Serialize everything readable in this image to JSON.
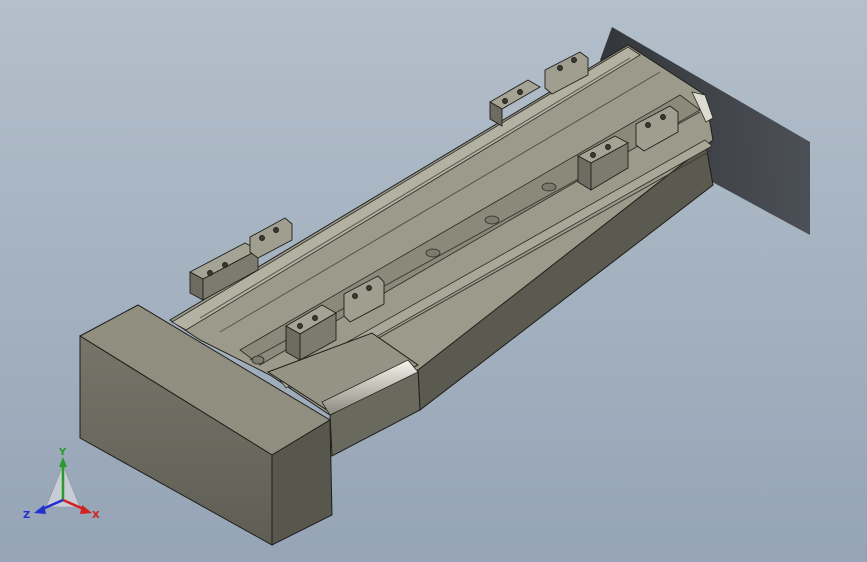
{
  "viewport": {
    "colors": {
      "background_top": "#b3bfca",
      "background_bottom": "#95a4b6",
      "part_top": "#9d9c8c",
      "part_front": "#6f6e62",
      "part_side": "#57564c",
      "edge": "#1e1e1a"
    }
  },
  "triad": {
    "labels": {
      "y": "Y",
      "x": "X",
      "z": "Z"
    },
    "colors": {
      "y": "#2a9b2a",
      "x": "#d42020",
      "z": "#2030d0"
    }
  }
}
